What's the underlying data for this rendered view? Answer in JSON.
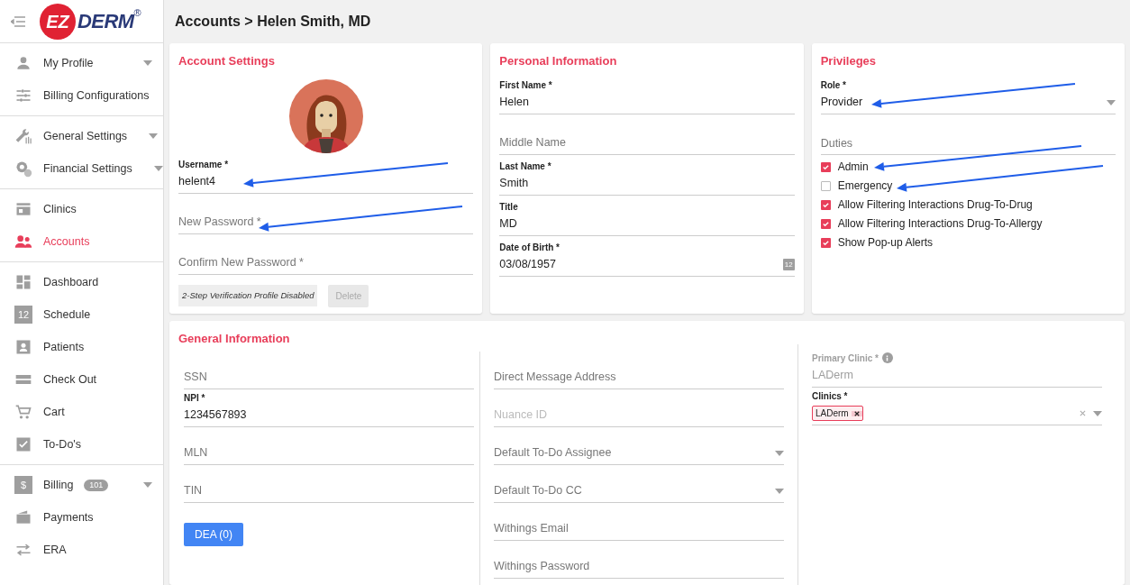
{
  "logo": {
    "mark": "EZ",
    "text": "DERM",
    "registered": "®"
  },
  "header": {
    "breadcrumb": "Accounts > Helen Smith, MD"
  },
  "sidebar": {
    "groups": [
      [
        {
          "label": "My Profile",
          "selected": false,
          "has_submenu": true
        },
        {
          "label": "Billing Configurations",
          "selected": false,
          "has_submenu": false
        }
      ],
      [
        {
          "label": "General Settings",
          "selected": false,
          "has_submenu": true
        },
        {
          "label": "Financial Settings",
          "selected": false,
          "has_submenu": true
        }
      ],
      [
        {
          "label": "Clinics",
          "selected": false,
          "has_submenu": false
        },
        {
          "label": "Accounts",
          "selected": true,
          "has_submenu": false
        }
      ],
      [
        {
          "label": "Dashboard",
          "selected": false,
          "has_submenu": false
        },
        {
          "label": "Schedule",
          "selected": false,
          "has_submenu": false,
          "icon_text": "12"
        },
        {
          "label": "Patients",
          "selected": false,
          "has_submenu": false
        },
        {
          "label": "Check Out",
          "selected": false,
          "has_submenu": false
        },
        {
          "label": "Cart",
          "selected": false,
          "has_submenu": false
        },
        {
          "label": "To-Do's",
          "selected": false,
          "has_submenu": false
        }
      ],
      [
        {
          "label": "Billing",
          "selected": false,
          "has_submenu": true,
          "badge": "101",
          "icon_text": "$"
        },
        {
          "label": "Payments",
          "selected": false,
          "has_submenu": false
        },
        {
          "label": "ERA",
          "selected": false,
          "has_submenu": false
        }
      ]
    ]
  },
  "account_settings": {
    "title": "Account Settings",
    "fields": [
      {
        "kind": "text",
        "label": "Username *",
        "value": "helent4"
      },
      {
        "kind": "text",
        "placeholder": "New Password *"
      },
      {
        "kind": "text",
        "placeholder": "Confirm New Password *"
      }
    ],
    "two_step_status": "2-Step Verification Profile Disabled",
    "delete_button": {
      "label": "Delete",
      "disabled": true
    }
  },
  "personal_information": {
    "title": "Personal Information",
    "fields": [
      {
        "kind": "text",
        "label": "First Name *",
        "value": "Helen"
      },
      {
        "kind": "text",
        "placeholder": "Middle Name"
      },
      {
        "kind": "text",
        "label": "Last Name *",
        "value": "Smith"
      },
      {
        "kind": "text",
        "label": "Title",
        "value": "MD"
      },
      {
        "kind": "date",
        "label": "Date of Birth *",
        "value": "03/08/1957",
        "icon_text": "12"
      }
    ]
  },
  "privileges": {
    "title": "Privileges",
    "fields": [
      {
        "kind": "select",
        "label": "Role *",
        "value": "Provider"
      }
    ],
    "duties_label": "Duties",
    "duties": [
      {
        "label": "Admin",
        "checked": true
      },
      {
        "label": "Emergency",
        "checked": false
      },
      {
        "label": "Allow Filtering Interactions Drug-To-Drug",
        "checked": true
      },
      {
        "label": "Allow Filtering Interactions Drug-To-Allergy",
        "checked": true
      },
      {
        "label": "Show Pop-up Alerts",
        "checked": true
      }
    ]
  },
  "general_information": {
    "title": "General Information",
    "columns": [
      [
        {
          "kind": "text",
          "placeholder": "SSN"
        },
        {
          "kind": "text",
          "label": "NPI *",
          "value": "1234567893"
        },
        {
          "kind": "text",
          "placeholder": "MLN"
        },
        {
          "kind": "text",
          "placeholder": "TIN"
        },
        {
          "kind": "button",
          "label": "DEA (0)"
        }
      ],
      [
        {
          "kind": "text",
          "placeholder": "Direct Message Address"
        },
        {
          "kind": "text",
          "placeholder": "Nuance ID",
          "disabled": true
        },
        {
          "kind": "select",
          "placeholder": "Default To-Do Assignee"
        },
        {
          "kind": "select",
          "placeholder": "Default To-Do CC"
        },
        {
          "kind": "text",
          "placeholder": "Withings Email"
        },
        {
          "kind": "text",
          "placeholder": "Withings Password"
        }
      ],
      [
        {
          "kind": "text",
          "label": "Primary Clinic *",
          "value": "LADerm",
          "disabled": true,
          "info": true
        },
        {
          "kind": "tags",
          "label": "Clinics *",
          "tags": [
            "LADerm"
          ]
        }
      ]
    ]
  }
}
